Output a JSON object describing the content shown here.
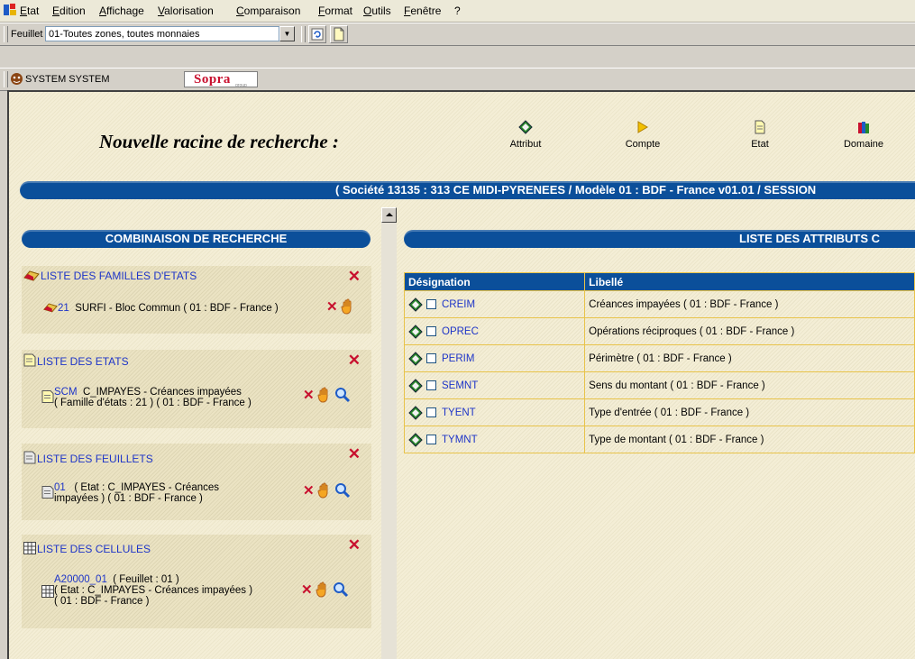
{
  "menubar": {
    "items": [
      "Etat",
      "Edition",
      "Affichage",
      "Valorisation",
      "Comparaison",
      "Format",
      "Outils",
      "Fenêtre",
      "?"
    ]
  },
  "toolbar": {
    "feuillet_label": "Feuillet :",
    "feuillet_value": "01-Toutes zones, toutes monnaies"
  },
  "userbar": {
    "user": "SYSTEM SYSTEM",
    "logo_text": "Sopra",
    "logo_sub": "group"
  },
  "header": {
    "title": "Nouvelle racine de recherche :",
    "actions": [
      {
        "label": "Attribut",
        "icon": "diamond-icon"
      },
      {
        "label": "Compte",
        "icon": "flag-icon"
      },
      {
        "label": "Etat",
        "icon": "document-icon"
      },
      {
        "label": "Domaine",
        "icon": "books-icon"
      }
    ]
  },
  "context_bar": "( Société 13135 : 313 CE MIDI-PYRENEES / Modèle 01 : BDF - France v01.01 / SESSION",
  "left_title": "COMBINAISON DE RECHERCHE",
  "right_title": "LISTE DES ATTRIBUTS C",
  "panels": {
    "familles": {
      "title": "LISTE DES FAMILLES D'ETATS",
      "code": "21",
      "text": "SURFI - Bloc Commun ( 01 : BDF - France )"
    },
    "etats": {
      "title": "LISTE DES ETATS",
      "code": "SCM",
      "line1": "C_IMPAYES - Créances impayées",
      "line2": "( Famille d'états : 21 ) ( 01 : BDF - France )"
    },
    "feuillets": {
      "title": "LISTE DES FEUILLETS",
      "code": "01",
      "line1": "( Etat : C_IMPAYES - Créances",
      "line2": "impayées ) ( 01 : BDF - France )"
    },
    "cellules": {
      "title": "LISTE DES CELLULES",
      "code": "A20000_01",
      "line1": "( Feuillet : 01 )",
      "line2": "( Etat : C_IMPAYES - Créances impayées )",
      "line3": "( 01 : BDF - France )"
    }
  },
  "table": {
    "headers": [
      "Désignation",
      "Libellé"
    ],
    "rows": [
      {
        "code": "CREIM",
        "libelle": "Créances impayées ( 01 : BDF - France )"
      },
      {
        "code": "OPREC",
        "libelle": "Opérations réciproques ( 01 : BDF - France )"
      },
      {
        "code": "PERIM",
        "libelle": "Périmètre ( 01 : BDF - France )"
      },
      {
        "code": "SEMNT",
        "libelle": "Sens du montant ( 01 : BDF - France )"
      },
      {
        "code": "TYENT",
        "libelle": "Type d'entrée ( 01 : BDF - France )"
      },
      {
        "code": "TYMNT",
        "libelle": "Type de montant ( 01 : BDF - France )"
      }
    ]
  },
  "colors": {
    "accent_blue": "#0b4f9a",
    "link_blue": "#1e35c8",
    "delete_red": "#c8102e",
    "table_border": "#e8c34a"
  }
}
